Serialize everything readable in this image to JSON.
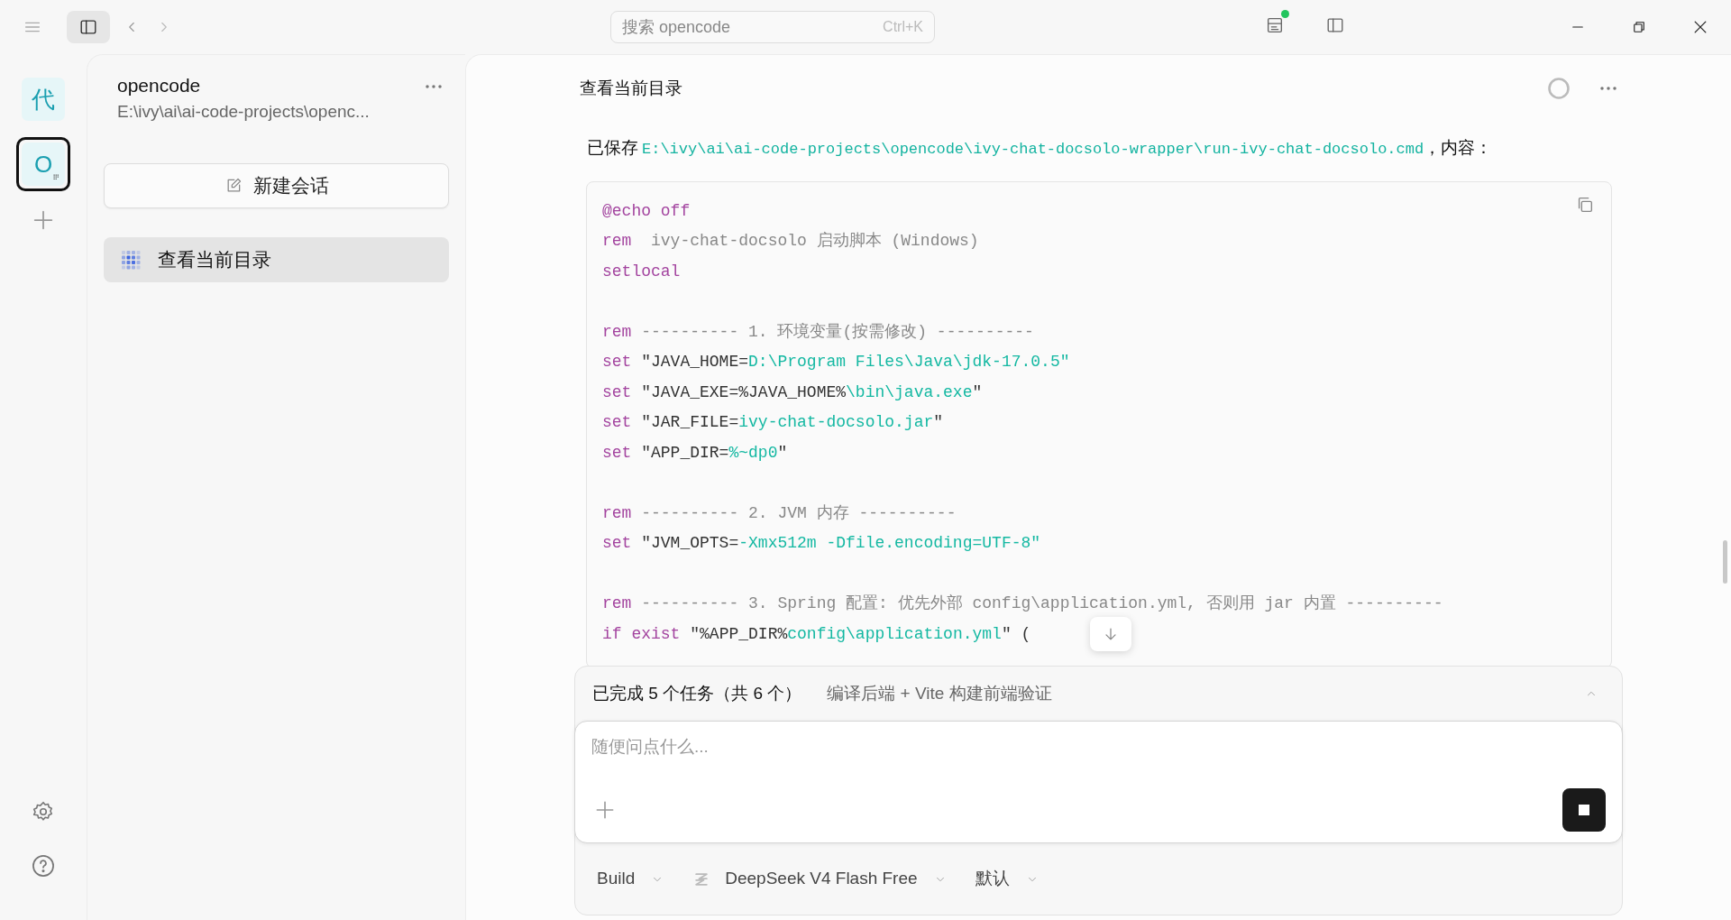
{
  "topbar": {
    "search": {
      "placeholder": "搜索 opencode",
      "shortcut": "Ctrl+K"
    },
    "sidebar_toggle": {
      "selected": true
    },
    "status_dot": {
      "color": "#22c55e"
    }
  },
  "rail": {
    "projects": [
      {
        "label": "代",
        "selected": false
      },
      {
        "label": "O",
        "selected": true
      }
    ]
  },
  "sidebar": {
    "project": {
      "name": "opencode",
      "path": "E:\\ivy\\ai\\ai-code-projects\\openc..."
    },
    "new_session": "新建会话",
    "sessions": [
      {
        "title": "查看当前目录",
        "selected": true
      }
    ]
  },
  "chat": {
    "title": "查看当前目录",
    "intro": {
      "prefix": "已保存 ",
      "path": "E:\\ivy\\ai\\ai-code-projects\\opencode\\ivy-chat-docsolo-wrapper\\run-ivy-chat-docsolo.cmd",
      "suffix": "，内容："
    },
    "code_lines": [
      {
        "kind": "code",
        "segments": [
          {
            "kind": "keyword",
            "text": "@echo off"
          }
        ]
      },
      {
        "kind": "code",
        "segments": [
          {
            "kind": "keyword",
            "text": "rem"
          },
          {
            "kind": "comment",
            "text": "  ivy-chat-docsolo 启动脚本 (Windows)"
          }
        ]
      },
      {
        "kind": "code",
        "segments": [
          {
            "kind": "keyword",
            "text": "setlocal"
          }
        ]
      },
      {
        "kind": "blank"
      },
      {
        "kind": "code",
        "segments": [
          {
            "kind": "keyword",
            "text": "rem"
          },
          {
            "kind": "comment",
            "text": " ---------- 1. 环境变量(按需修改) ----------"
          }
        ]
      },
      {
        "kind": "code",
        "segments": [
          {
            "kind": "keyword",
            "text": "set"
          },
          {
            "kind": "plain",
            "text": " \"JAVA_HOME="
          },
          {
            "kind": "string",
            "text": "D:\\Program Files\\Java\\jdk-17.0.5\""
          }
        ]
      },
      {
        "kind": "code",
        "segments": [
          {
            "kind": "keyword",
            "text": "set"
          },
          {
            "kind": "plain",
            "text": " \"JAVA_EXE=%JAVA_HOME%"
          },
          {
            "kind": "string",
            "text": "\\bin\\java.exe"
          },
          {
            "kind": "plain",
            "text": "\""
          }
        ]
      },
      {
        "kind": "code",
        "segments": [
          {
            "kind": "keyword",
            "text": "set"
          },
          {
            "kind": "plain",
            "text": " \"JAR_FILE="
          },
          {
            "kind": "string",
            "text": "ivy-chat-docsolo.jar"
          },
          {
            "kind": "plain",
            "text": "\""
          }
        ]
      },
      {
        "kind": "code",
        "segments": [
          {
            "kind": "keyword",
            "text": "set"
          },
          {
            "kind": "plain",
            "text": " \"APP_DIR="
          },
          {
            "kind": "string",
            "text": "%~dp0"
          },
          {
            "kind": "plain",
            "text": "\""
          }
        ]
      },
      {
        "kind": "blank"
      },
      {
        "kind": "code",
        "segments": [
          {
            "kind": "keyword",
            "text": "rem"
          },
          {
            "kind": "comment",
            "text": " ---------- 2. JVM 内存 ----------"
          }
        ]
      },
      {
        "kind": "code",
        "segments": [
          {
            "kind": "keyword",
            "text": "set"
          },
          {
            "kind": "plain",
            "text": " \"JVM_OPTS="
          },
          {
            "kind": "string",
            "text": "-Xmx512m -Dfile.encoding=UTF-8\""
          }
        ]
      },
      {
        "kind": "blank"
      },
      {
        "kind": "code",
        "segments": [
          {
            "kind": "keyword",
            "text": "rem"
          },
          {
            "kind": "comment",
            "text": " ---------- 3. Spring 配置: 优先外部 config\\application.yml, 否则用 jar 内置 ----------"
          }
        ]
      },
      {
        "kind": "code",
        "segments": [
          {
            "kind": "keyword",
            "text": "if exist"
          },
          {
            "kind": "plain",
            "text": " \"%APP_DIR%"
          },
          {
            "kind": "string",
            "text": "config\\application.yml"
          },
          {
            "kind": "plain",
            "text": "\" ("
          }
        ]
      }
    ]
  },
  "composer": {
    "tasks": {
      "summary": "已完成 5 个任务（共 6 个）",
      "current": "编译后端 + Vite 构建前端验证"
    },
    "input": {
      "placeholder": "随便问点什么..."
    },
    "options": [
      {
        "kind": "mode",
        "label": "Build"
      },
      {
        "kind": "model",
        "label": "DeepSeek V4 Flash Free"
      },
      {
        "kind": "variant",
        "label": "默认"
      }
    ]
  }
}
